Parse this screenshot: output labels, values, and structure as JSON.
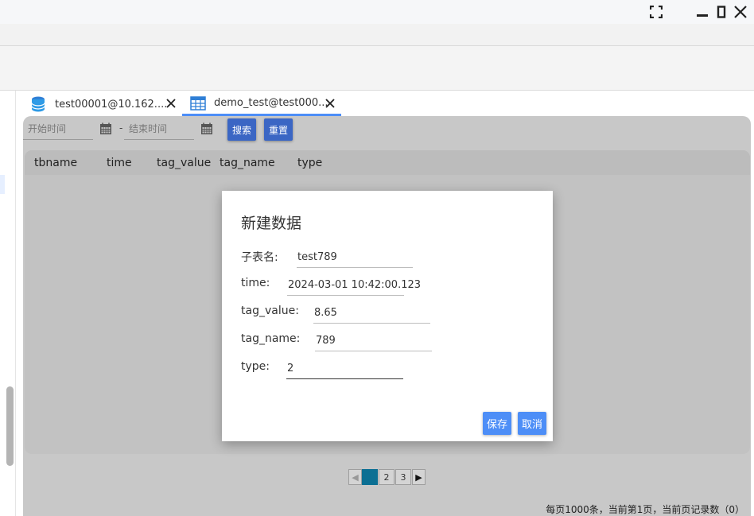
{
  "window": {
    "controls": [
      {
        "icon": "fullscreen-icon"
      },
      {
        "icon": "minimize-icon"
      },
      {
        "icon": "maximize-icon"
      },
      {
        "icon": "close-icon"
      }
    ]
  },
  "tabs": [
    {
      "label": "test00001@10.162....",
      "icon": "database-icon",
      "active": false
    },
    {
      "label": "demo_test@test000...",
      "icon": "table-icon",
      "active": true
    }
  ],
  "filter": {
    "start_placeholder": "开始时间",
    "end_placeholder": "结束时间",
    "separator": "-",
    "search_label": "搜索",
    "reset_label": "重置"
  },
  "table": {
    "columns": [
      "tbname",
      "time",
      "tag_value",
      "tag_name",
      "type"
    ]
  },
  "pager": {
    "pages": [
      "1",
      "2",
      "3"
    ],
    "current": "1"
  },
  "footer": {
    "status": "每页1000条，当前第1页，当前页记录数（0）"
  },
  "dialog": {
    "title": "新建数据",
    "fields": [
      {
        "label": "子表名:",
        "value": "test789"
      },
      {
        "label": "time:",
        "value": "2024-03-01 10:42:00.123"
      },
      {
        "label": "tag_value:",
        "value": "8.65"
      },
      {
        "label": "tag_name:",
        "value": "789"
      },
      {
        "label": "type:",
        "value": "2"
      }
    ],
    "save_label": "保存",
    "cancel_label": "取消"
  },
  "colors": {
    "accent": "#4d8ef7",
    "filter_button": "#3b66c4",
    "current_page": "#0b6f93"
  }
}
